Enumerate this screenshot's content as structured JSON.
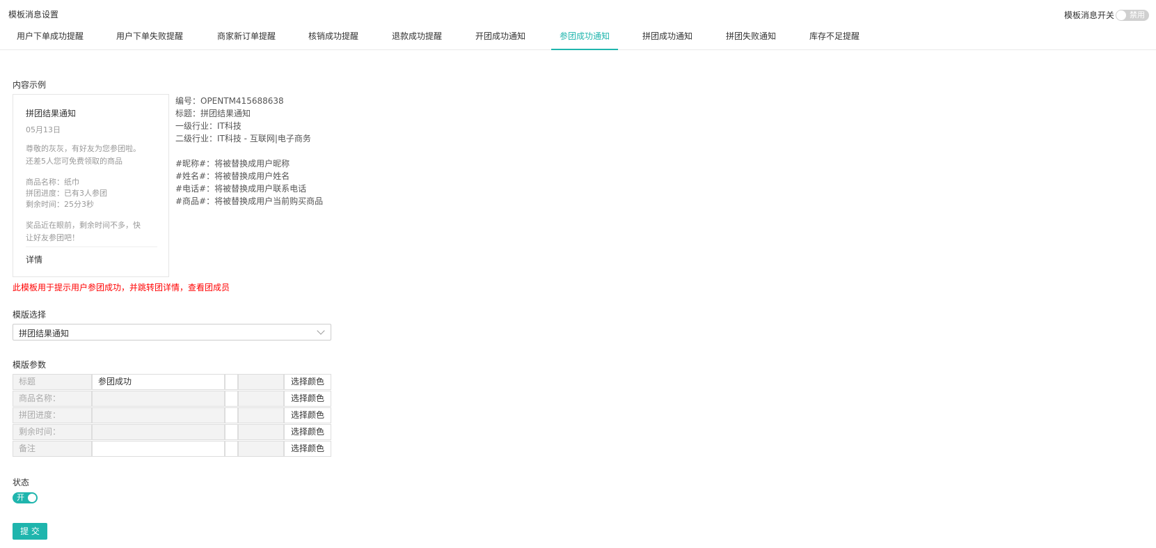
{
  "header": {
    "title": "模板消息设置",
    "global_switch": {
      "label": "模板消息开关",
      "state_text": "禁用",
      "enabled": false
    }
  },
  "tabs": [
    {
      "label": "用户下单成功提醒",
      "active": false
    },
    {
      "label": "用户下单失败提醒",
      "active": false
    },
    {
      "label": "商家新订单提醒",
      "active": false
    },
    {
      "label": "核销成功提醒",
      "active": false
    },
    {
      "label": "退款成功提醒",
      "active": false
    },
    {
      "label": "开团成功通知",
      "active": false
    },
    {
      "label": "参团成功通知",
      "active": true
    },
    {
      "label": "拼团成功通知",
      "active": false
    },
    {
      "label": "拼团失败通知",
      "active": false
    },
    {
      "label": "库存不足提醒",
      "active": false
    }
  ],
  "example": {
    "section_label": "内容示例",
    "card": {
      "title": "拼团结果通知",
      "date": "05月13日",
      "greeting_1": "尊敬的灰灰，有好友为您参团啦。",
      "greeting_2": "还差5人您可免费领取的商品",
      "product": "商品名称：纸巾",
      "progress": "拼团进度：已有3人参团",
      "remaining": "剩余时间：25分3秒",
      "remark_1": "奖品近在眼前，剩余时间不多，快",
      "remark_2": "让好友参团吧！",
      "detail": "详情"
    },
    "meta": {
      "code": "编号：OPENTM415688638",
      "title": "标题：拼团结果通知",
      "industry1": "一级行业：IT科技",
      "industry2": "二级行业：IT科技 - 互联网|电子商务",
      "var_nickname": "#昵称#：将被替换成用户昵称",
      "var_name": "#姓名#：将被替换成用户姓名",
      "var_phone": "#电话#：将被替换成用户联系电话",
      "var_product": "#商品#：将被替换成用户当前购买商品"
    },
    "note": "此模板用于提示用户参团成功，并跳转团详情，查看团成员"
  },
  "template_select": {
    "label": "模版选择",
    "value": "拼团结果通知"
  },
  "params": {
    "label": "模版参数",
    "color_button_label": "选择颜色",
    "rows": [
      {
        "label": "标题",
        "value": "参团成功",
        "editable": true
      },
      {
        "label": "商品名称：",
        "value": "",
        "editable": false
      },
      {
        "label": "拼团进度：",
        "value": "",
        "editable": false
      },
      {
        "label": "剩余时间：",
        "value": "",
        "editable": false
      },
      {
        "label": "备注",
        "value": "",
        "editable": true
      }
    ]
  },
  "status": {
    "label": "状态",
    "switch_text": "开",
    "enabled": true
  },
  "submit_label": "提 交",
  "colors": {
    "accent": "#1fb5ad",
    "warning": "#ff0000"
  }
}
